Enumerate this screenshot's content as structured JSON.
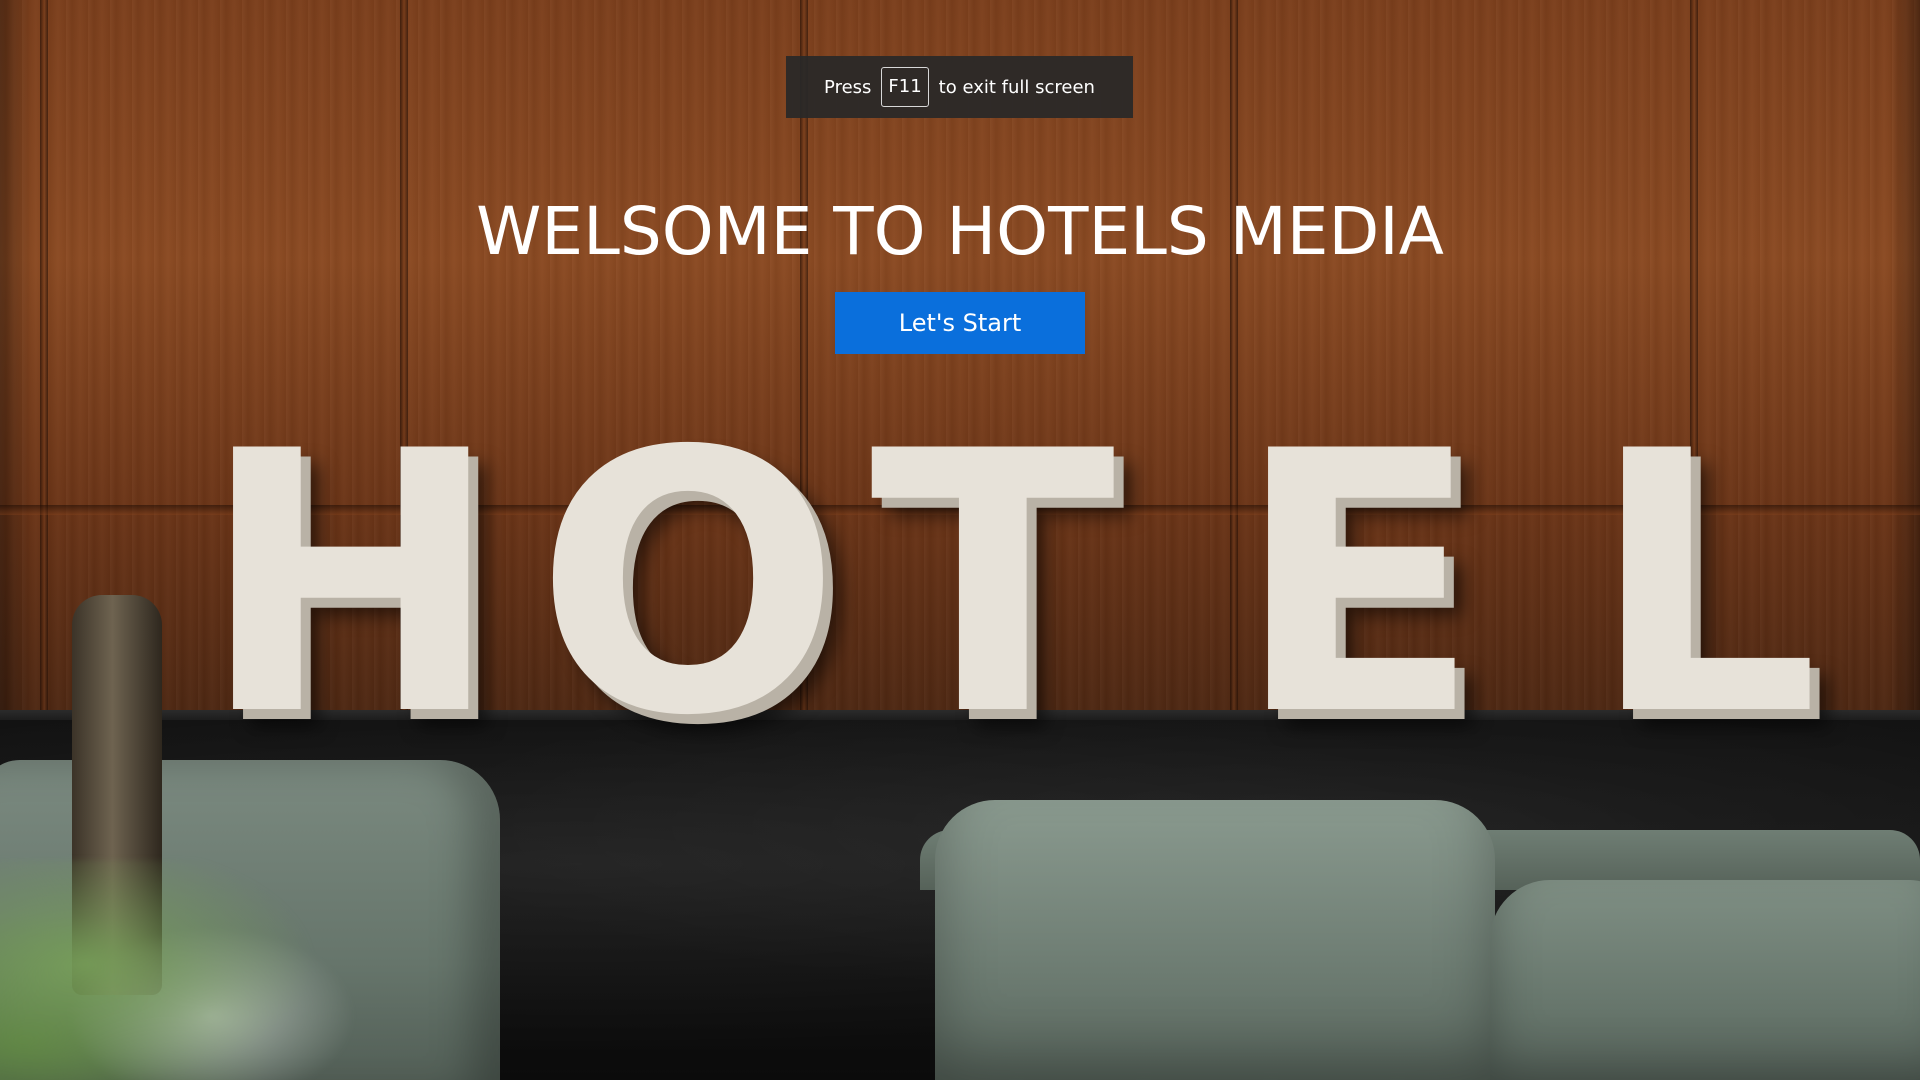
{
  "fullscreen_notice": {
    "prefix": "Press",
    "key": "F11",
    "suffix": "to exit full screen"
  },
  "hero": {
    "title": "WELSOME TO HOTELS MEDIA",
    "start_button_label": "Let's Start"
  },
  "background": {
    "sign_letters": [
      "H",
      "O",
      "T",
      "E",
      "L"
    ],
    "colors": {
      "wall": "#7c3f1c",
      "shelf": "#111111",
      "sofa": "#7b8a80",
      "button": "#0a6fdc"
    }
  }
}
